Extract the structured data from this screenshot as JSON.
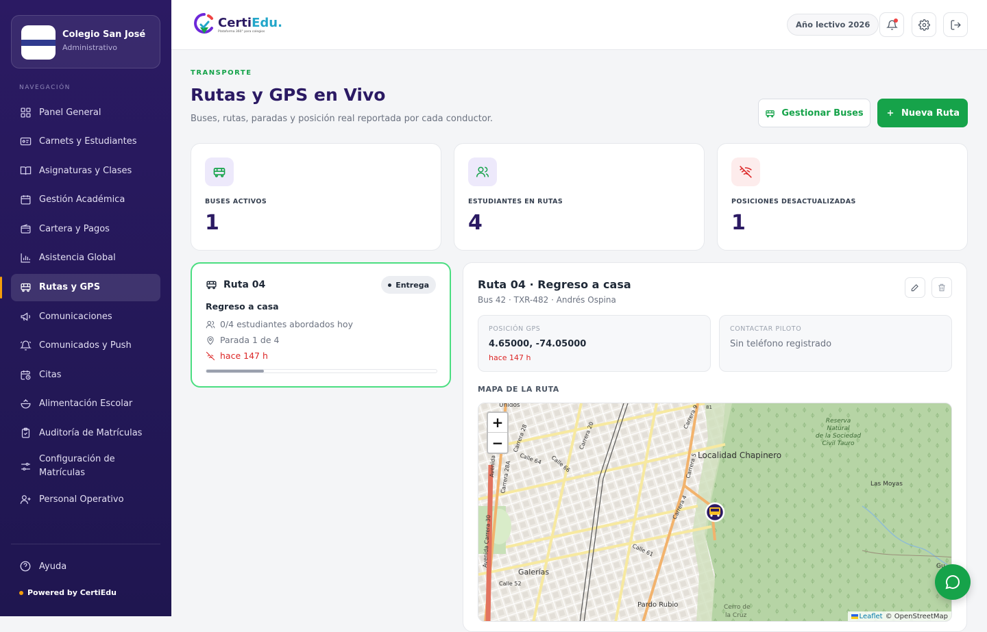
{
  "school": {
    "name": "Colegio San José",
    "role": "Administrativo"
  },
  "nav": {
    "heading": "NAVEGACIÓN",
    "items": [
      {
        "label": "Panel General",
        "icon": "grid-icon"
      },
      {
        "label": "Carnets y Estudiantes",
        "icon": "id-card-icon"
      },
      {
        "label": "Asignaturas y Clases",
        "icon": "book-icon"
      },
      {
        "label": "Gestión Académica",
        "icon": "calendar-icon"
      },
      {
        "label": "Cartera y Pagos",
        "icon": "wallet-icon"
      },
      {
        "label": "Asistencia Global",
        "icon": "bar-chart-icon"
      },
      {
        "label": "Rutas y GPS",
        "icon": "bus-icon"
      },
      {
        "label": "Comunicaciones",
        "icon": "megaphone-icon"
      },
      {
        "label": "Comunicados y Push",
        "icon": "bell-ring-icon"
      },
      {
        "label": "Citas",
        "icon": "calendar-clock-icon"
      },
      {
        "label": "Alimentación Escolar",
        "icon": "bowl-icon"
      },
      {
        "label": "Auditoría de Matrículas",
        "icon": "clipboard-check-icon"
      },
      {
        "label": "Configuración de Matrículas",
        "icon": "sliders-icon"
      },
      {
        "label": "Personal Operativo",
        "icon": "user-plus-icon"
      }
    ],
    "active": "Rutas y GPS",
    "help": "Ayuda",
    "powered": "Powered by CertiEdu"
  },
  "topbar": {
    "brand": "CertiEdu",
    "brand_main": "Certi",
    "brand_accent": "Edu.",
    "brand_sub": "Plataforma 360° para colegios",
    "year": "Año lectivo 2026"
  },
  "page": {
    "crumb": "TRANSPORTE",
    "title": "Rutas y GPS en Vivo",
    "subtitle": "Buses, rutas, paradas y posición real reportada por cada conductor.",
    "btn_manage": "Gestionar Buses",
    "btn_new": "Nueva Ruta"
  },
  "stats": [
    {
      "label": "BUSES ACTIVOS",
      "value": "1",
      "icon": "bus-icon"
    },
    {
      "label": "ESTUDIANTES EN RUTAS",
      "value": "4",
      "icon": "users-icon"
    },
    {
      "label": "POSICIONES DESACTUALIZADAS",
      "value": "1",
      "icon": "wifi-off-icon"
    }
  ],
  "route_card": {
    "name": "Ruta 04",
    "badge": "Entrega",
    "description": "Regreso a casa",
    "students": "0/4 estudiantes abordados hoy",
    "stop": "Parada 1 de 4",
    "updated": "hace 147 h",
    "progress": 0.25
  },
  "detail": {
    "title": "Ruta 04 · Regreso a casa",
    "subtitle": "Bus 42 · TXR-482 · Andrés Ospina",
    "gps_label": "POSICIÓN GPS",
    "gps_value": "4.65000, -74.05000",
    "gps_time": "hace 147 h",
    "contact_label": "CONTACTAR PILOTO",
    "contact_value": "Sin teléfono registrado",
    "map_label": "MAPA DE LA RUTA"
  },
  "map": {
    "zoom_in": "+",
    "zoom_out": "−",
    "attribution_leaflet": "Leaflet",
    "attribution_osm": "© OpenStreetMap",
    "labels": {
      "chapinero": "Localidad Chapinero",
      "reserva": [
        "Reserva",
        "Natural",
        "de la Sociedad",
        "Civil Tauro"
      ],
      "las_moyas": "Las Moyas",
      "galerias": "Galerías",
      "pardo": "Pardo Rubio",
      "cerro": [
        "Cerro de",
        "la Cruz"
      ],
      "calle64": "Calle 64",
      "calle66": "Calle 66",
      "calle61": "Calle 61",
      "calle52": "Calle 52",
      "carrera28": "Carrera 28",
      "carrera28a": "Carrera 28A",
      "carrera20": "Carrera 20",
      "carrera9": "Carrera 9",
      "carrera5": "Carrera 5",
      "carrera4": "Carrera 4",
      "av30": "Avenida Carrera 30",
      "avenida": "Avenida",
      "unidos": "Unidos",
      "n81": "81",
      "gu": "Gu"
    }
  },
  "colors": {
    "brand": "#2b1a63",
    "accent": "#16a34a",
    "danger": "#dc2626"
  }
}
